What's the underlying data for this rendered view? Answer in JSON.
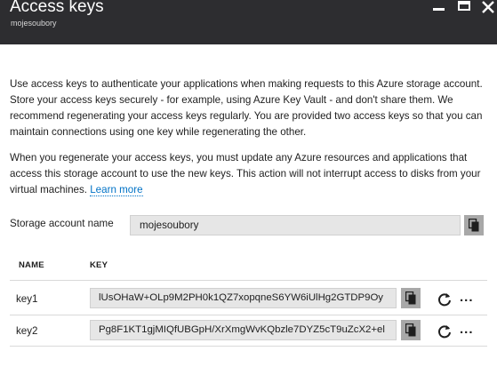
{
  "header": {
    "title": "Access keys",
    "subtitle": "mojesoubory"
  },
  "intro": {
    "paragraph1": "Use access keys to authenticate your applications when making requests to this Azure storage account. Store your access keys securely - for example, using Azure Key Vault - and don't share them. We recommend regenerating your access keys regularly. You are provided two access keys so that you can maintain connections using one key while regenerating the other.",
    "paragraph2": "When you regenerate your access keys, you must update any Azure resources and applications that access this storage account to use the new keys. This action will not interrupt access to disks from your virtual machines.",
    "learn_more": "Learn more"
  },
  "storage_account": {
    "label": "Storage account name",
    "value": "mojesoubory"
  },
  "table": {
    "headers": {
      "name": "NAME",
      "key": "KEY"
    },
    "rows": [
      {
        "name": "key1",
        "key": "lUsOHaW+OLp9M2PH0k1QZ7xopqneS6YW6iUlHg2GTDP9Oy"
      },
      {
        "name": "key2",
        "key": "Pg8F1KT1gjMIQfUBGpH/XrXmgWvKQbzle7DYZ5cT9uZcX2+el"
      }
    ],
    "more_label": "..."
  },
  "icons": {
    "minimize": "minimize-icon",
    "maximize": "maximize-icon",
    "close": "close-icon",
    "copy": "copy-icon",
    "regenerate": "refresh-icon"
  },
  "colors": {
    "header_bg": "#2d2d30",
    "link": "#0072c6",
    "input_bg": "#e6e6e6",
    "copy_button_bg": "#a8a8a8"
  }
}
